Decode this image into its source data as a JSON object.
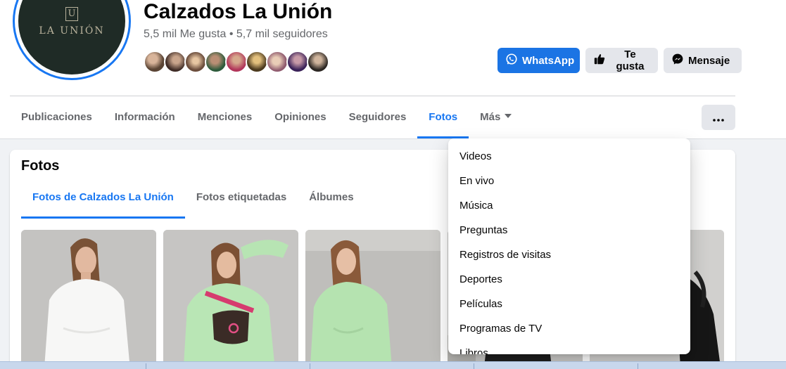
{
  "page": {
    "name": "Calzados La Unión",
    "stats": "5,5 mil Me gusta • 5,7 mil seguidores",
    "logo_mark": "U",
    "logo_text": "LA UNIÓN"
  },
  "actions": {
    "whatsapp": "WhatsApp",
    "like": "Te gusta",
    "message": "Mensaje"
  },
  "tabs": [
    {
      "label": "Publicaciones"
    },
    {
      "label": "Información"
    },
    {
      "label": "Menciones"
    },
    {
      "label": "Opiniones"
    },
    {
      "label": "Seguidores"
    },
    {
      "label": "Fotos",
      "active": true
    },
    {
      "label": "Más"
    }
  ],
  "photos_section": {
    "title": "Fotos",
    "subtabs": [
      {
        "label": "Fotos de Calzados La Unión",
        "active": true
      },
      {
        "label": "Fotos etiquetadas"
      },
      {
        "label": "Álbumes"
      }
    ]
  },
  "more_menu": {
    "items": [
      "Videos",
      "En vivo",
      "Música",
      "Preguntas",
      "Registros de visitas",
      "Deportes",
      "Películas",
      "Programas de TV",
      "Libros"
    ]
  },
  "colors": {
    "accent": "#1877f2",
    "button_primary": "#1b74e4",
    "button_secondary": "#e4e6eb",
    "logo_bg": "#1f2b26"
  },
  "icons": [
    "whatsapp-icon",
    "thumbs-up-icon",
    "messenger-icon",
    "chevron-down-icon",
    "ellipsis-icon"
  ]
}
